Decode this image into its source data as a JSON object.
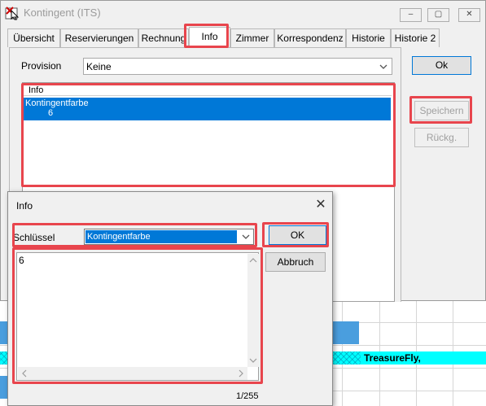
{
  "window": {
    "title": "Kontingent (ITS)",
    "controls": [
      "minimize",
      "maximize",
      "close"
    ]
  },
  "tabs": [
    {
      "label": "Übersicht",
      "active": false
    },
    {
      "label": "Reservierungen",
      "active": false
    },
    {
      "label": "Rechnung",
      "active": false
    },
    {
      "label": "Info",
      "active": true
    },
    {
      "label": "Zimmer",
      "active": false
    },
    {
      "label": "Korrespondenz",
      "active": false
    },
    {
      "label": "Historie",
      "active": false
    },
    {
      "label": "Historie 2",
      "active": false
    }
  ],
  "provision": {
    "label": "Provision",
    "value": "Keine"
  },
  "info_list": {
    "header": "Info",
    "rows": [
      {
        "key": "Kontingentfarbe",
        "value": "6"
      }
    ]
  },
  "side_buttons": {
    "ok": "Ok",
    "save": "Speichern",
    "back": "Rückg."
  },
  "background": {
    "booking_label": "TreasureFly,"
  },
  "dialog": {
    "title": "Info",
    "key_label": "Schlüssel",
    "key_value": "Kontingentfarbe",
    "ok": "OK",
    "cancel": "Abbruch",
    "text_value": "6",
    "char_counter": "1/255"
  },
  "colors": {
    "selection": "#0078d7",
    "highlight": "#e8454d",
    "booking_bar": "#00ffff",
    "booking_block": "#4a9ede"
  }
}
